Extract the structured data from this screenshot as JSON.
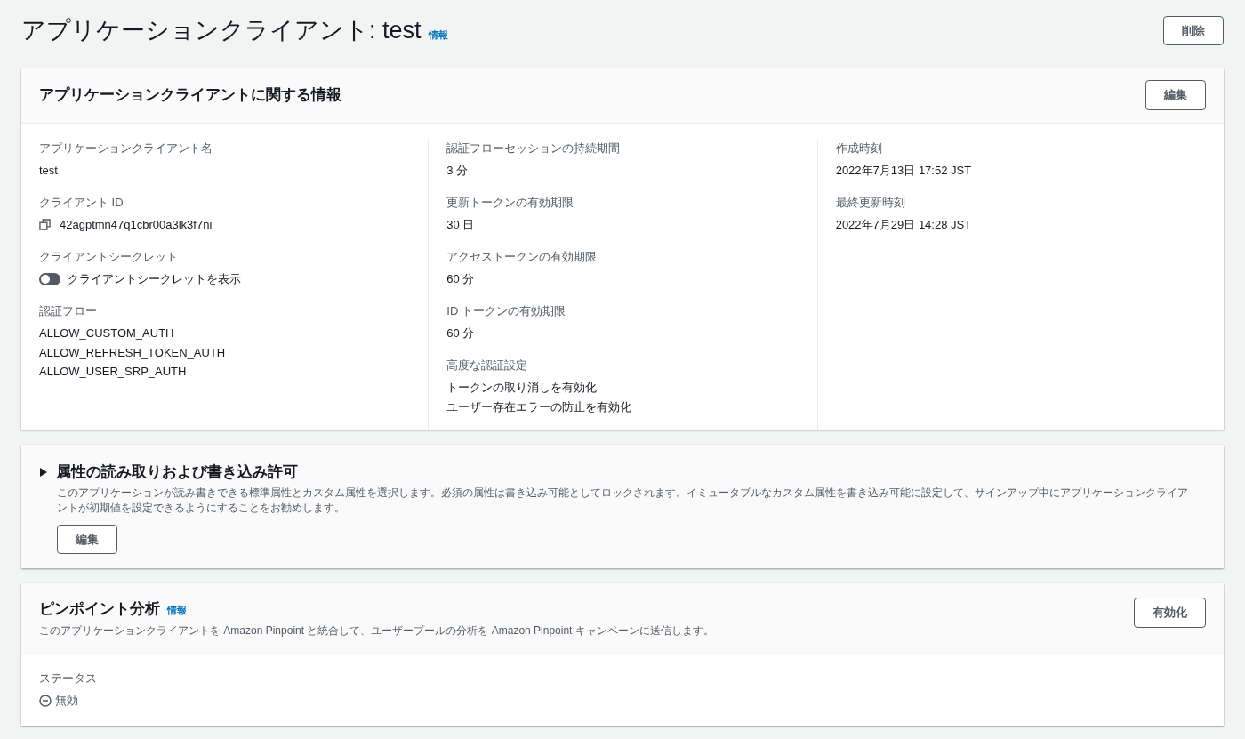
{
  "page": {
    "title": "アプリケーションクライアント: test",
    "info_link": "情報",
    "delete_button": "削除"
  },
  "client_info": {
    "title": "アプリケーションクライアントに関する情報",
    "edit_button": "編集",
    "columns": [
      [
        {
          "kind": "text",
          "label": "アプリケーションクライアント名",
          "value": "test"
        },
        {
          "kind": "copy",
          "label": "クライアント ID",
          "value": "42agptmn47q1cbr00a3lk3f7ni"
        },
        {
          "kind": "toggle",
          "label": "クライアントシークレット",
          "value": "クライアントシークレットを表示",
          "on": false
        },
        {
          "kind": "list",
          "label": "認証フロー",
          "values": [
            "ALLOW_CUSTOM_AUTH",
            "ALLOW_REFRESH_TOKEN_AUTH",
            "ALLOW_USER_SRP_AUTH"
          ]
        }
      ],
      [
        {
          "kind": "text",
          "label": "認証フローセッションの持続期間",
          "value": "3 分"
        },
        {
          "kind": "text",
          "label": "更新トークンの有効期限",
          "value": "30 日"
        },
        {
          "kind": "text",
          "label": "アクセストークンの有効期限",
          "value": "60 分"
        },
        {
          "kind": "text",
          "label": "ID トークンの有効期限",
          "value": "60 分"
        },
        {
          "kind": "list",
          "label": "高度な認証設定",
          "values": [
            "トークンの取り消しを有効化",
            "ユーザー存在エラーの防止を有効化"
          ]
        }
      ],
      [
        {
          "kind": "text",
          "label": "作成時刻",
          "value": "2022年7月13日 17:52 JST"
        },
        {
          "kind": "text",
          "label": "最終更新時刻",
          "value": "2022年7月29日 14:28 JST"
        }
      ]
    ]
  },
  "attributes": {
    "title": "属性の読み取りおよび書き込み許可",
    "expanded": false,
    "description": "このアプリケーションが読み書きできる標準属性とカスタム属性を選択します。必須の属性は書き込み可能としてロックされます。イミュータブルなカスタム属性を書き込み可能に設定して、サインアップ中にアプリケーションクライアントが初期値を設定できるようにすることをお勧めします。",
    "edit_button": "編集"
  },
  "pinpoint": {
    "title": "ピンポイント分析",
    "info_link": "情報",
    "description": "このアプリケーションクライアントを Amazon Pinpoint と統合して、ユーザープールの分析を Amazon Pinpoint キャンペーンに送信します。",
    "enable_button": "有効化",
    "status_label": "ステータス",
    "status_value": "無効"
  }
}
